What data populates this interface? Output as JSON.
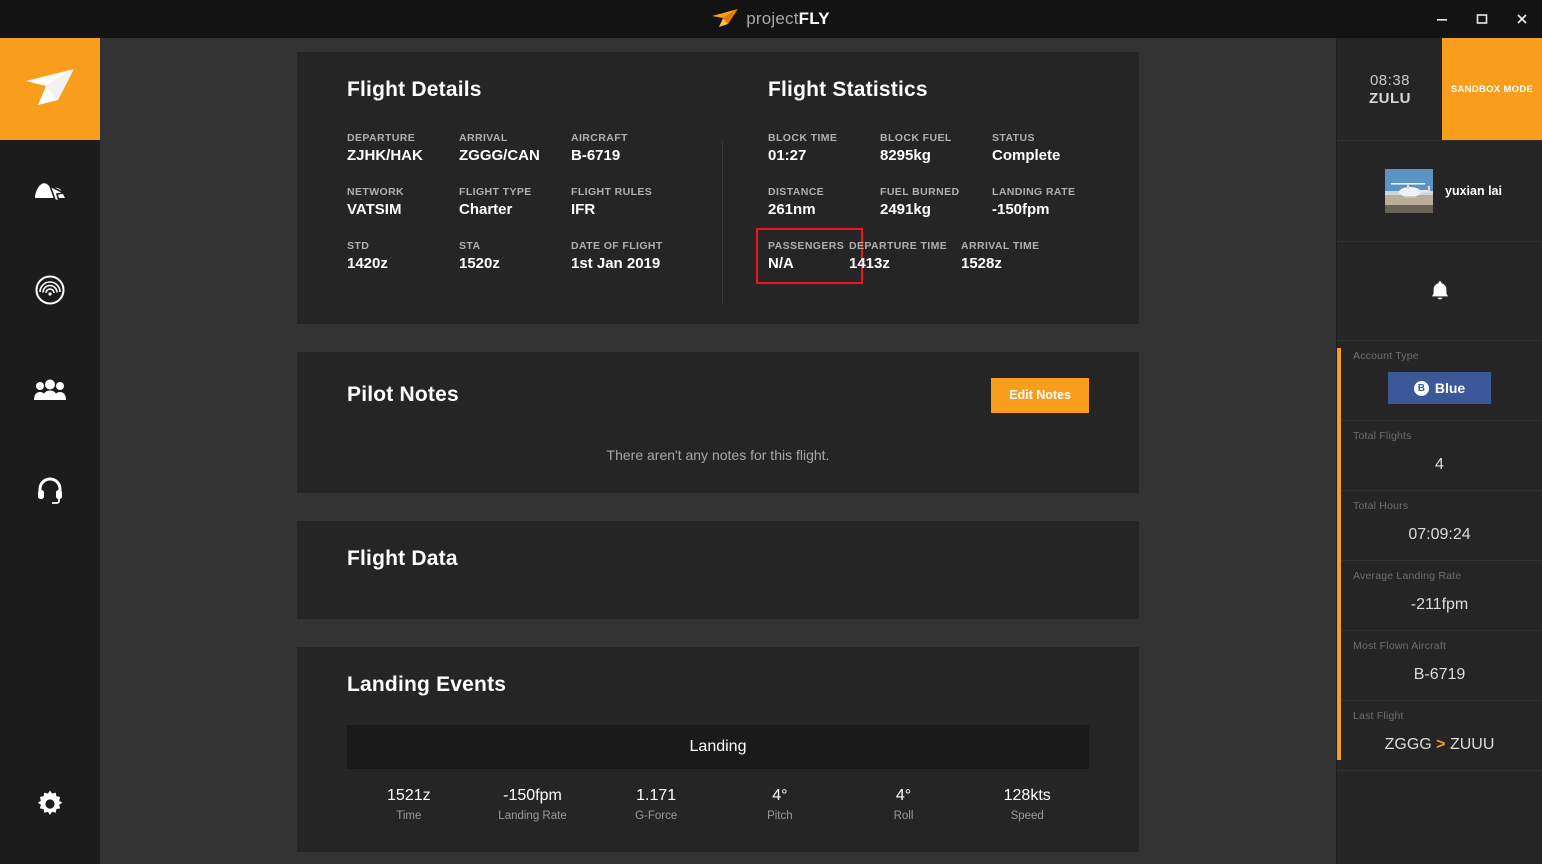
{
  "window": {
    "brand_prefix": "project",
    "brand_suffix": "FLY",
    "logo_icon": "paper-plane-icon",
    "minimize_label": "Minimize",
    "maximize_label": "Maximize",
    "close_label": "Close"
  },
  "sidebar": {
    "logo_icon": "paper-plane-logo-icon",
    "items": [
      {
        "icon": "map-cursor-icon",
        "label": "Map"
      },
      {
        "icon": "radar-target-icon",
        "label": "Radar"
      },
      {
        "icon": "group-people-icon",
        "label": "Community"
      },
      {
        "icon": "headset-icon",
        "label": "ATC"
      }
    ],
    "settings": {
      "icon": "gear-icon",
      "label": "Settings"
    }
  },
  "flight_details": {
    "title": "Flight Details",
    "fields": [
      {
        "label": "DEPARTURE",
        "value": "ZJHK/HAK"
      },
      {
        "label": "ARRIVAL",
        "value": "ZGGG/CAN"
      },
      {
        "label": "AIRCRAFT",
        "value": "B-6719"
      },
      {
        "label": "NETWORK",
        "value": "VATSIM"
      },
      {
        "label": "FLIGHT TYPE",
        "value": "Charter"
      },
      {
        "label": "FLIGHT RULES",
        "value": "IFR"
      },
      {
        "label": "STD",
        "value": "1420z"
      },
      {
        "label": "STA",
        "value": "1520z"
      },
      {
        "label": "DATE OF FLIGHT",
        "value": "1st Jan 2019"
      }
    ]
  },
  "flight_statistics": {
    "title": "Flight Statistics",
    "fields": [
      {
        "label": "BLOCK TIME",
        "value": "01:27",
        "highlight": false
      },
      {
        "label": "BLOCK FUEL",
        "value": "8295kg",
        "highlight": false
      },
      {
        "label": "STATUS",
        "value": "Complete",
        "highlight": false
      },
      {
        "label": "DISTANCE",
        "value": "261nm",
        "highlight": false
      },
      {
        "label": "FUEL BURNED",
        "value": "2491kg",
        "highlight": false
      },
      {
        "label": "LANDING RATE",
        "value": "-150fpm",
        "highlight": false
      },
      {
        "label": "PASSENGERS",
        "value": "N/A",
        "highlight": true
      },
      {
        "label": "DEPARTURE TIME",
        "value": "1413z",
        "highlight": false
      },
      {
        "label": "ARRIVAL TIME",
        "value": "1528z",
        "highlight": false
      }
    ],
    "highlight_color": "#f0141e"
  },
  "pilot_notes": {
    "title": "Pilot Notes",
    "edit_button": "Edit Notes",
    "empty_text": "There aren't any notes for this flight."
  },
  "flight_data": {
    "title": "Flight Data"
  },
  "landing_events": {
    "title": "Landing Events",
    "group_header": "Landing",
    "columns": [
      {
        "value": "1521z",
        "label": "Time"
      },
      {
        "value": "-150fpm",
        "label": "Landing Rate"
      },
      {
        "value": "1.171",
        "label": "G-Force"
      },
      {
        "value": "4°",
        "label": "Pitch"
      },
      {
        "value": "4°",
        "label": "Roll"
      },
      {
        "value": "128kts",
        "label": "Speed"
      }
    ]
  },
  "right_panel": {
    "clock": {
      "time": "08:38",
      "zone": "ZULU"
    },
    "sandbox_badge": "SANDBOX MODE",
    "user": {
      "name": "yuxian lai",
      "avatar_icon": "helicopter-photo-avatar"
    },
    "notifications_icon": "bell-icon",
    "stats": [
      {
        "label": "Account Type",
        "value": "Blue",
        "type": "badge",
        "badge_color": "#3b5998",
        "badge_mark": "B"
      },
      {
        "label": "Total Flights",
        "value": "4",
        "type": "text"
      },
      {
        "label": "Total Hours",
        "value": "07:09:24",
        "type": "text"
      },
      {
        "label": "Average Landing Rate",
        "value": "-211fpm",
        "type": "text"
      },
      {
        "label": "Most Flown Aircraft",
        "value": "B-6719",
        "type": "text"
      },
      {
        "label": "Last Flight",
        "value": "ZGGG > ZUUU",
        "type": "route",
        "route_from": "ZGGG",
        "route_to": "ZUUU",
        "route_arrow": ">"
      }
    ]
  },
  "theme": {
    "accent_orange": "#f99d1c",
    "page_bg": "#333333",
    "card_bg": "#252525",
    "panel_bg": "#252525",
    "sidebar_bg": "#1c1c1c"
  }
}
